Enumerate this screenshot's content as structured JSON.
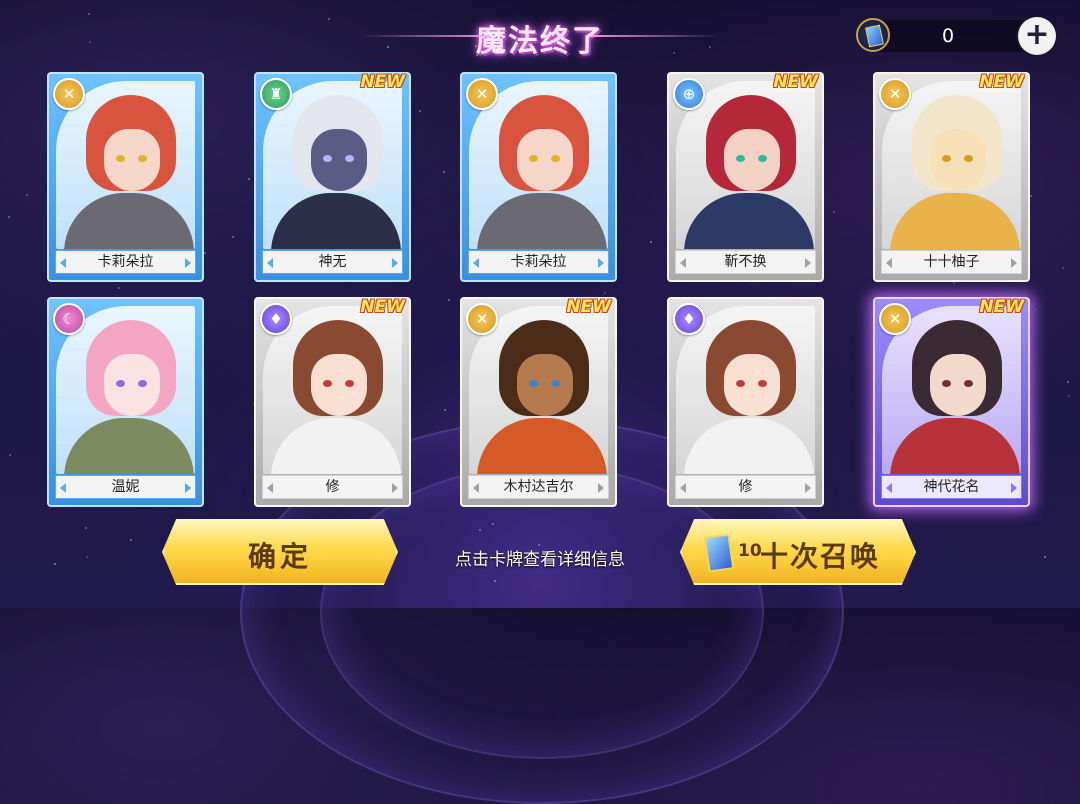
{
  "header": {
    "title": "魔法终了",
    "currency_value": "0",
    "currency_icon": "summon-ticket-icon",
    "add_icon": "plus-icon"
  },
  "cards": [
    {
      "name": "卡莉朵拉",
      "rarity": "blue",
      "badge": "gold",
      "badge_icon": "crossed-swords-icon",
      "is_new": false,
      "hair": "#d9543f",
      "skin": "#f6d6c8",
      "outfit": "#6b6a72",
      "eye": "#e2b12a"
    },
    {
      "name": "神无",
      "rarity": "blue",
      "badge": "green",
      "badge_icon": "tower-icon",
      "is_new": true,
      "hair": "#e4e6ee",
      "skin": "#5a5c86",
      "outfit": "#2c2f4a",
      "eye": "#b9b2ff"
    },
    {
      "name": "卡莉朵拉",
      "rarity": "blue",
      "badge": "gold",
      "badge_icon": "crossed-swords-icon",
      "is_new": false,
      "hair": "#d9543f",
      "skin": "#f6d6c8",
      "outfit": "#6b6a72",
      "eye": "#e2b12a"
    },
    {
      "name": "靳不换",
      "rarity": "gray",
      "badge": "blue",
      "badge_icon": "crosshair-icon",
      "is_new": true,
      "hair": "#b4283a",
      "skin": "#f3d2c4",
      "outfit": "#2d3a66",
      "eye": "#2fb8a0"
    },
    {
      "name": "十十柚子",
      "rarity": "gray",
      "badge": "gold",
      "badge_icon": "crossed-swords-icon",
      "is_new": true,
      "hair": "#f1e6c9",
      "skin": "#f7e0b8",
      "outfit": "#e8b34a",
      "eye": "#d99a1f"
    },
    {
      "name": "温妮",
      "rarity": "blue",
      "badge": "pink",
      "badge_icon": "crescent-orb-icon",
      "is_new": false,
      "hair": "#f3a6c3",
      "skin": "#fbe2e2",
      "outfit": "#7c8a60",
      "eye": "#8f6bd6"
    },
    {
      "name": "修",
      "rarity": "gray",
      "badge": "purple",
      "badge_icon": "blade-icon",
      "is_new": true,
      "hair": "#8a4a32",
      "skin": "#f8dfd2",
      "outfit": "#f2f2f2",
      "eye": "#c23a3a"
    },
    {
      "name": "木村达吉尔",
      "rarity": "gray",
      "badge": "gold",
      "badge_icon": "crossed-swords-icon",
      "is_new": true,
      "hair": "#4a2c18",
      "skin": "#b57a4e",
      "outfit": "#d45a28",
      "eye": "#3f7fd0"
    },
    {
      "name": "修",
      "rarity": "gray",
      "badge": "purple",
      "badge_icon": "blade-icon",
      "is_new": false,
      "hair": "#8a4a32",
      "skin": "#f8dfd2",
      "outfit": "#f2f2f2",
      "eye": "#c23a3a"
    },
    {
      "name": "神代花名",
      "rarity": "purple",
      "badge": "gold",
      "badge_icon": "crossed-swords-icon",
      "is_new": true,
      "hair": "#3a2a33",
      "skin": "#f3d8cc",
      "outfit": "#b8323a",
      "eye": "#7a2a3a"
    }
  ],
  "new_label": "NEW",
  "footer": {
    "confirm_label": "确定",
    "hint": "点击卡牌查看详细信息",
    "summon_cost": "10",
    "summon_label": "十次召唤",
    "summon_icon": "summon-ticket-icon"
  }
}
